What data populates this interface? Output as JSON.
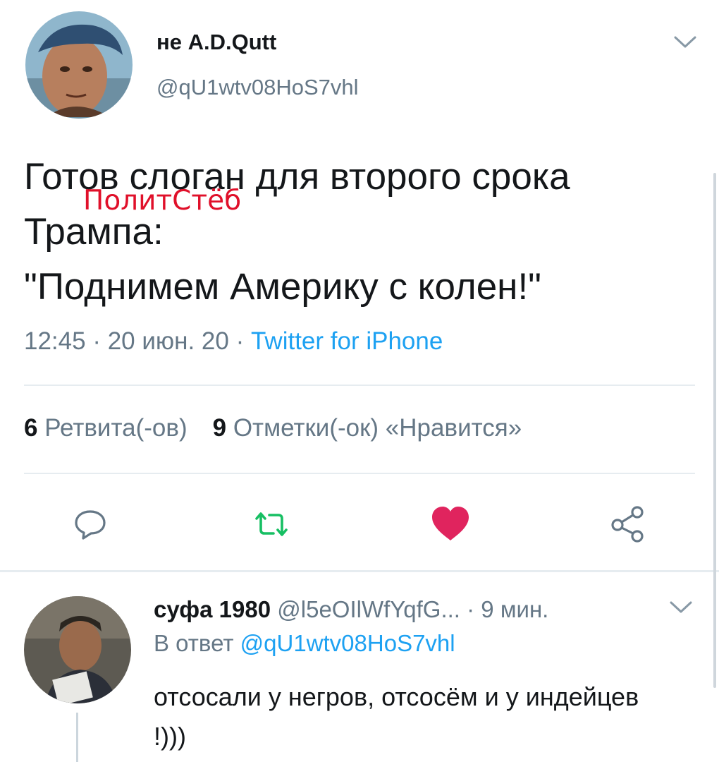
{
  "tweet": {
    "author_name": "не A.D.Qutt",
    "author_handle": "@qU1wtv08HoS7vhl",
    "text": "Готов слоган для второго срока Трампа:\n\"Поднимем Америку с колен!\"",
    "watermark": "ПолитСтёб",
    "time": "12:45",
    "date": "20 июн. 20",
    "source": "Twitter for iPhone",
    "retweets_count": "6",
    "retweets_label": "Ретвита(-ов)",
    "likes_count": "9",
    "likes_label": "Отметки(-ок) «Нравится»",
    "liked": true,
    "icons": [
      "reply-icon",
      "retweet-icon",
      "heart-icon",
      "share-icon",
      "chevron-down-icon"
    ],
    "colors": {
      "like": "#e0245e",
      "retweet": "#17bf63",
      "link": "#1da1f2",
      "muted": "#657786"
    }
  },
  "reply": {
    "author_name": "суфа 1980",
    "author_handle": "@l5eOIlWfYqfG...",
    "time": "9 мин.",
    "replying_prefix": "В ответ",
    "replying_to": "@qU1wtv08HoS7vhl",
    "text": "отсосали у негров, отсосём и у индейцев !)))"
  },
  "sep": " · "
}
